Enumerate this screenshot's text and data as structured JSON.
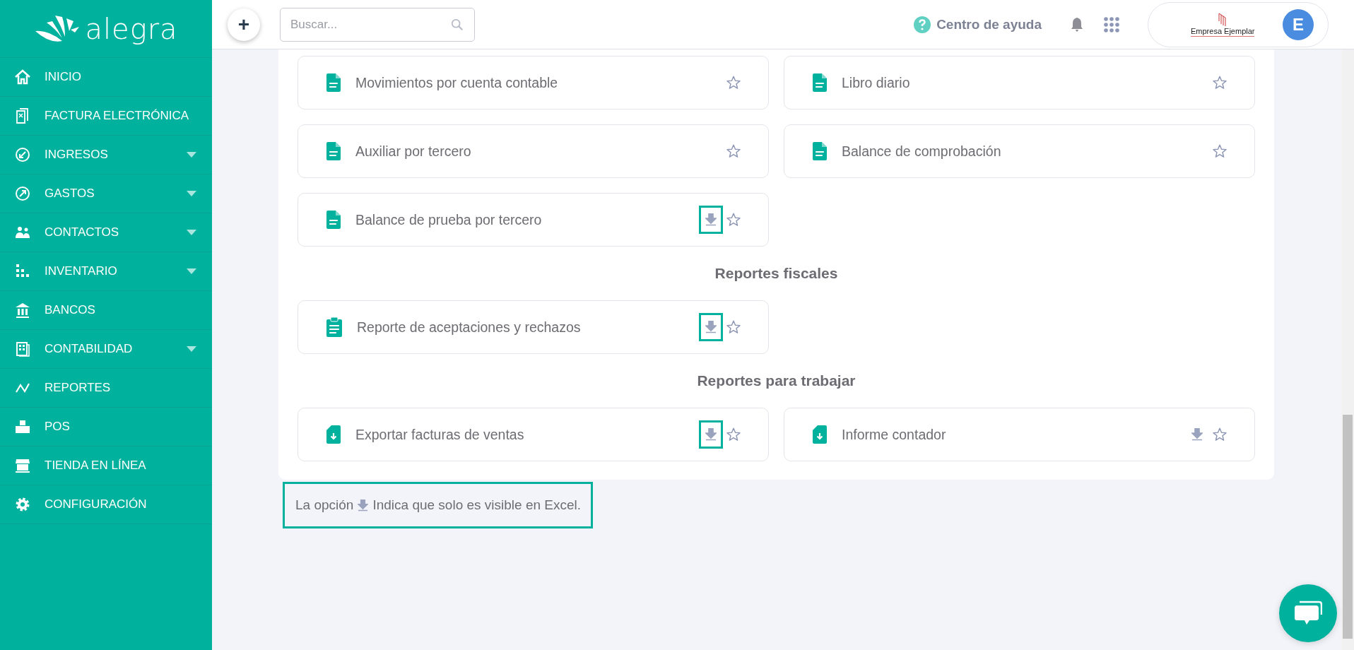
{
  "sidebar": {
    "logo": "alegra",
    "items": [
      {
        "label": "INICIO",
        "submenu": false
      },
      {
        "label": "FACTURA ELECTRÓNICA",
        "submenu": false
      },
      {
        "label": "INGRESOS",
        "submenu": true
      },
      {
        "label": "GASTOS",
        "submenu": true
      },
      {
        "label": "CONTACTOS",
        "submenu": true
      },
      {
        "label": "INVENTARIO",
        "submenu": true
      },
      {
        "label": "BANCOS",
        "submenu": false
      },
      {
        "label": "CONTABILIDAD",
        "submenu": true
      },
      {
        "label": "REPORTES",
        "submenu": false
      },
      {
        "label": "POS",
        "submenu": false
      },
      {
        "label": "TIENDA EN LÍNEA",
        "submenu": false
      },
      {
        "label": "CONFIGURACIÓN",
        "submenu": false
      }
    ]
  },
  "header": {
    "add_button": "+",
    "search": {
      "placeholder": "Buscar..."
    },
    "help": "Centro de ayuda",
    "company": {
      "name": "Empresa Ejemplar",
      "avatar": "E"
    }
  },
  "sections": [
    {
      "cards": [
        {
          "label": "Movimientos por cuenta contable",
          "kind": "document",
          "download": false
        },
        {
          "label": "Libro diario",
          "kind": "document",
          "download": false
        },
        {
          "label": "Auxiliar por tercero",
          "kind": "document",
          "download": false
        },
        {
          "label": "Balance de comprobación",
          "kind": "document",
          "download": false
        },
        {
          "label": "Balance de prueba por tercero",
          "kind": "document",
          "download": true,
          "highlighted": true
        }
      ]
    },
    {
      "title": "Reportes fiscales",
      "cards": [
        {
          "label": "Reporte de aceptaciones y rechazos",
          "kind": "clipboard",
          "download": true,
          "highlighted": true
        }
      ]
    },
    {
      "title": "Reportes para trabajar",
      "cards": [
        {
          "label": "Exportar facturas de ventas",
          "kind": "export",
          "download": true,
          "highlighted": true
        },
        {
          "label": "Informe contador",
          "kind": "export",
          "download": true,
          "highlighted": false
        }
      ]
    }
  ],
  "note": {
    "before": "La opción",
    "after": "Indica que solo es visible en Excel.",
    "highlighted": true
  }
}
